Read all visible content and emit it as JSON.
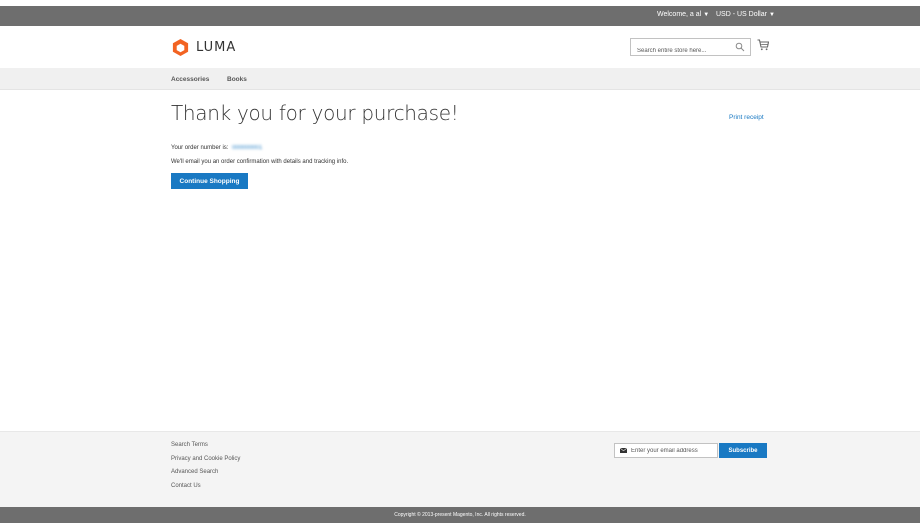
{
  "colors": {
    "accent": "#1979c3",
    "panel_bar": "#6e6e6e",
    "nav_background": "#f0f0f0",
    "footer_background": "#f4f4f4",
    "logo_orange": "#f26322"
  },
  "header_panel": {
    "welcome_text": "Welcome, a al",
    "welcome_icon": "chevron-down-icon",
    "currency_text": "USD - US Dollar",
    "currency_icon": "chevron-down-icon"
  },
  "header": {
    "logo_text": "LUMA",
    "search": {
      "placeholder": "Search entire store here...",
      "value": "",
      "icon": "search-icon"
    },
    "cart_icon": "cart-icon"
  },
  "navigation": {
    "items": [
      {
        "label": "Accessories"
      },
      {
        "label": "Books"
      }
    ]
  },
  "main": {
    "title": "Thank you for your purchase!",
    "print_receipt": "Print receipt",
    "order_label": "Your order number is:",
    "order_number": "000000001",
    "email_text": "We'll email you an order confirmation with details and tracking info.",
    "continue_button": "Continue Shopping"
  },
  "footer": {
    "links": [
      {
        "label": "Search Terms"
      },
      {
        "label": "Privacy and Cookie Policy"
      },
      {
        "label": "Advanced Search"
      },
      {
        "label": "Contact Us"
      }
    ],
    "newsletter": {
      "placeholder": "Enter your email address",
      "value": "",
      "icon": "envelope-icon"
    },
    "subscribe_button": "Subscribe",
    "copyright": "Copyright © 2013-present Magento, Inc. All rights reserved."
  }
}
